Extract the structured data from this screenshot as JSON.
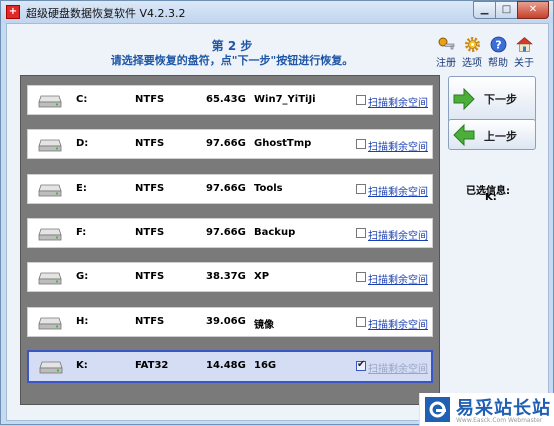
{
  "window": {
    "app_icon_glyph": "+",
    "title": "超级硬盘数据恢复软件 V4.2.3.2",
    "controls": {
      "minimize": "▁",
      "maximize": "□",
      "close": "✕"
    }
  },
  "header": {
    "step": "第 2 步",
    "instruction": "请选择要恢复的盘符，点\"下一步\"按钮进行恢复。"
  },
  "toolbar": {
    "register": {
      "label": "注册",
      "icon": "key-icon"
    },
    "options": {
      "label": "选项",
      "icon": "gear-icon"
    },
    "help": {
      "label": "帮助",
      "icon": "help-icon"
    },
    "about": {
      "label": "关于",
      "icon": "house-icon"
    }
  },
  "drives": [
    {
      "letter": "C:",
      "fs": "NTFS",
      "size": "65.43G",
      "label": "Win7_YiTiJi",
      "scan_label": "扫描剩余空间",
      "checked": false,
      "selected": false
    },
    {
      "letter": "D:",
      "fs": "NTFS",
      "size": "97.66G",
      "label": "GhostTmp",
      "scan_label": "扫描剩余空间",
      "checked": false,
      "selected": false
    },
    {
      "letter": "E:",
      "fs": "NTFS",
      "size": "97.66G",
      "label": "Tools",
      "scan_label": "扫描剩余空间",
      "checked": false,
      "selected": false
    },
    {
      "letter": "F:",
      "fs": "NTFS",
      "size": "97.66G",
      "label": "Backup",
      "scan_label": "扫描剩余空间",
      "checked": false,
      "selected": false
    },
    {
      "letter": "G:",
      "fs": "NTFS",
      "size": "38.37G",
      "label": "XP",
      "scan_label": "扫描剩余空间",
      "checked": false,
      "selected": false
    },
    {
      "letter": "H:",
      "fs": "NTFS",
      "size": "39.06G",
      "label": "镜像",
      "scan_label": "扫描剩余空间",
      "checked": false,
      "selected": false
    },
    {
      "letter": "K:",
      "fs": "FAT32",
      "size": "14.48G",
      "label": "16G",
      "scan_label": "扫描剩余空间",
      "checked": true,
      "selected": true
    }
  ],
  "nav": {
    "next_label": "下一步",
    "prev_label": "上一步"
  },
  "selected_info": {
    "title": "已选信息:",
    "value": "K:"
  },
  "watermark": {
    "text": "易采站长站",
    "sub": "Www.Easck.Com Webmaster"
  },
  "colors": {
    "accent_blue": "#3a56c6",
    "arrow_green": "#4caf3a",
    "step_text": "#1f57a6"
  }
}
